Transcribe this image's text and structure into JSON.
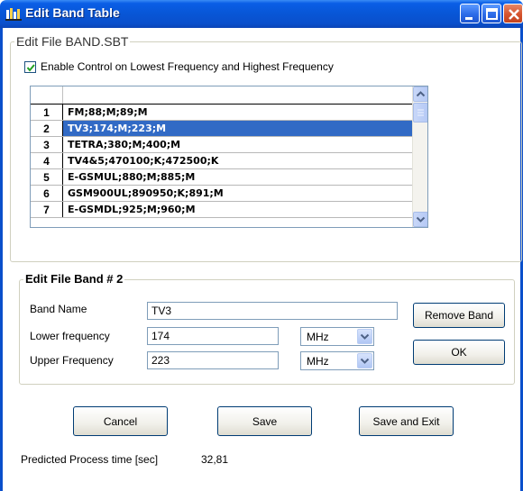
{
  "window": {
    "title": "Edit Band Table"
  },
  "file_group": {
    "title": "Edit File BAND.SBT",
    "checkbox_label": "Enable Control on Lowest Frequency and Highest Frequency",
    "checkbox_checked": true
  },
  "band_list": {
    "selected_index": 1,
    "rows": [
      {
        "num": "1",
        "value": "FM;88;M;89;M"
      },
      {
        "num": "2",
        "value": "TV3;174;M;223;M"
      },
      {
        "num": "3",
        "value": "TETRA;380;M;400;M"
      },
      {
        "num": "4",
        "value": "TV4&5;470100;K;472500;K"
      },
      {
        "num": "5",
        "value": "E-GSMUL;880;M;885;M"
      },
      {
        "num": "6",
        "value": "GSM900UL;890950;K;891;M"
      },
      {
        "num": "7",
        "value": "E-GSMDL;925;M;960;M"
      }
    ]
  },
  "band_group": {
    "title": "Edit File Band # 2",
    "name_label": "Band Name",
    "name_value": "TV3",
    "lower_label": "Lower frequency",
    "lower_value": "174",
    "lower_unit": "MHz",
    "upper_label": "Upper Frequency",
    "upper_value": "223",
    "upper_unit": "MHz",
    "remove_label": "Remove Band",
    "ok_label": "OK"
  },
  "actions": {
    "cancel_label": "Cancel",
    "save_label": "Save",
    "save_exit_label": "Save and Exit"
  },
  "status": {
    "label": "Predicted Process time [sec]",
    "value": "32,81"
  },
  "colors": {
    "titlebar": "#0a5ee6",
    "selection": "#316ac5",
    "check": "#21a121"
  }
}
